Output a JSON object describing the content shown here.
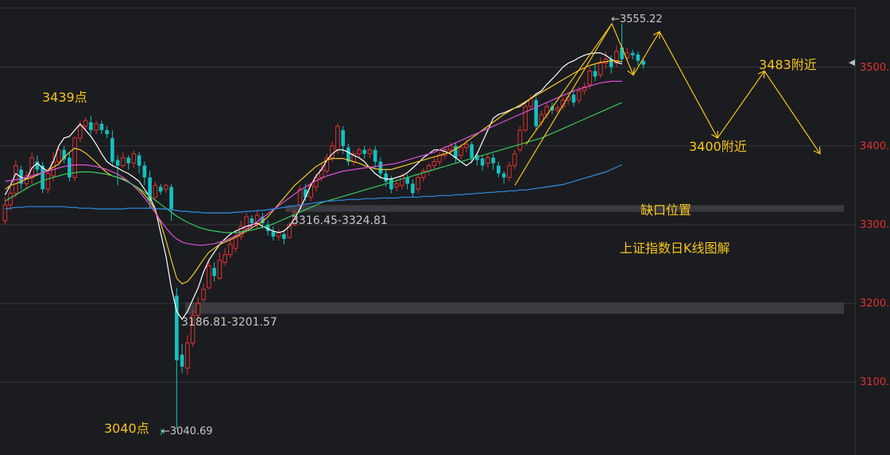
{
  "colors": {
    "background": "#1b1c20",
    "grid": "#34353a",
    "up": "#e0322e",
    "down": "#12c2c0",
    "tick": "#e0322e",
    "annotation": "#f5c518",
    "gap_zone": "#3a3b40",
    "ma5": "#ffffff",
    "ma10": "#f0c828",
    "ma20": "#e050d8",
    "ma30": "#38c860",
    "ma60": "#2f8fe8"
  },
  "chart_data": {
    "type": "candlestick",
    "title": "上证指数日K线图解",
    "ylim": [
      3025,
      3575
    ],
    "y_ticks": [
      "3500.",
      "3400.",
      "3300.",
      "3200.",
      "3100."
    ],
    "grid": true,
    "extreme_labels": {
      "high": "←3555.22",
      "low": "←3040.69",
      "gap_upper": "3316.45-3324.81",
      "gap_lower": "3186.81-3201.57"
    },
    "gaps": [
      {
        "low": 3316.45,
        "high": 3324.81
      },
      {
        "low": 3186.81,
        "high": 3201.57
      }
    ],
    "annotations": {
      "peak_left": "3439点",
      "bottom": "3040点",
      "gap_position": "缺口位置",
      "target_low": "3400附近",
      "target_high": "3483附近"
    },
    "candles": [
      [
        3305,
        3325,
        3300,
        3335
      ],
      [
        3325,
        3340,
        3318,
        3348
      ],
      [
        3340,
        3375,
        3335,
        3382
      ],
      [
        3370,
        3352,
        3345,
        3375
      ],
      [
        3352,
        3362,
        3345,
        3368
      ],
      [
        3360,
        3385,
        3352,
        3392
      ],
      [
        3380,
        3370,
        3362,
        3388
      ],
      [
        3375,
        3345,
        3340,
        3380
      ],
      [
        3345,
        3365,
        3340,
        3372
      ],
      [
        3362,
        3380,
        3355,
        3392
      ],
      [
        3380,
        3395,
        3375,
        3398
      ],
      [
        3395,
        3383,
        3378,
        3400
      ],
      [
        3385,
        3360,
        3355,
        3392
      ],
      [
        3360,
        3410,
        3355,
        3412
      ],
      [
        3410,
        3425,
        3405,
        3432
      ],
      [
        3425,
        3432,
        3420,
        3436
      ],
      [
        3430,
        3420,
        3415,
        3438
      ],
      [
        3420,
        3428,
        3415,
        3432
      ],
      [
        3428,
        3420,
        3415,
        3432
      ],
      [
        3420,
        3415,
        3410,
        3425
      ],
      [
        3410,
        3380,
        3375,
        3420
      ],
      [
        3382,
        3375,
        3350,
        3388
      ],
      [
        3375,
        3385,
        3372,
        3392
      ],
      [
        3385,
        3378,
        3370,
        3388
      ],
      [
        3378,
        3390,
        3372,
        3394
      ],
      [
        3388,
        3375,
        3365,
        3392
      ],
      [
        3375,
        3360,
        3350,
        3380
      ],
      [
        3360,
        3330,
        3320,
        3368
      ],
      [
        3335,
        3350,
        3330,
        3355
      ],
      [
        3348,
        3342,
        3338,
        3352
      ],
      [
        3345,
        3350,
        3340,
        3352
      ],
      [
        3348,
        3320,
        3305,
        3352
      ],
      [
        3210,
        3128,
        3040.69,
        3220
      ],
      [
        3135,
        3120,
        3112,
        3148
      ],
      [
        3118,
        3150,
        3110,
        3160
      ],
      [
        3150,
        3185,
        3145,
        3192
      ],
      [
        3185,
        3200,
        3180,
        3208
      ],
      [
        3205,
        3218,
        3202,
        3225
      ],
      [
        3220,
        3248,
        3218,
        3255
      ],
      [
        3245,
        3235,
        3228,
        3252
      ],
      [
        3232,
        3255,
        3230,
        3265
      ],
      [
        3252,
        3262,
        3248,
        3270
      ],
      [
        3262,
        3275,
        3258,
        3282
      ],
      [
        3270,
        3285,
        3265,
        3292
      ],
      [
        3285,
        3298,
        3280,
        3305
      ],
      [
        3295,
        3310,
        3290,
        3315
      ],
      [
        3308,
        3302,
        3295,
        3312
      ],
      [
        3300,
        3312,
        3295,
        3318
      ],
      [
        3310,
        3302,
        3295,
        3315
      ],
      [
        3300,
        3292,
        3286,
        3305
      ],
      [
        3292,
        3285,
        3280,
        3298
      ],
      [
        3285,
        3290,
        3280,
        3295
      ],
      [
        3288,
        3282,
        3275,
        3294
      ],
      [
        3284,
        3300,
        3282,
        3303
      ],
      [
        3300,
        3316,
        3298,
        3318
      ],
      [
        3325,
        3345,
        3320,
        3350
      ],
      [
        3345,
        3335,
        3330,
        3352
      ],
      [
        3335,
        3350,
        3330,
        3354
      ],
      [
        3348,
        3360,
        3342,
        3365
      ],
      [
        3360,
        3370,
        3355,
        3378
      ],
      [
        3368,
        3385,
        3365,
        3390
      ],
      [
        3385,
        3400,
        3380,
        3405
      ],
      [
        3395,
        3425,
        3390,
        3428
      ],
      [
        3420,
        3400,
        3390,
        3425
      ],
      [
        3398,
        3380,
        3375,
        3403
      ],
      [
        3380,
        3390,
        3375,
        3394
      ],
      [
        3390,
        3395,
        3384,
        3398
      ],
      [
        3395,
        3390,
        3384,
        3400
      ],
      [
        3390,
        3395,
        3384,
        3398
      ],
      [
        3395,
        3380,
        3372,
        3400
      ],
      [
        3380,
        3365,
        3358,
        3385
      ],
      [
        3365,
        3355,
        3348,
        3370
      ],
      [
        3358,
        3345,
        3340,
        3362
      ],
      [
        3348,
        3352,
        3342,
        3358
      ],
      [
        3350,
        3362,
        3345,
        3365
      ],
      [
        3360,
        3352,
        3345,
        3364
      ],
      [
        3352,
        3340,
        3335,
        3358
      ],
      [
        3345,
        3360,
        3340,
        3365
      ],
      [
        3360,
        3368,
        3355,
        3372
      ],
      [
        3368,
        3375,
        3362,
        3378
      ],
      [
        3375,
        3380,
        3370,
        3385
      ],
      [
        3380,
        3388,
        3375,
        3393
      ],
      [
        3388,
        3395,
        3383,
        3398
      ],
      [
        3395,
        3400,
        3390,
        3404
      ],
      [
        3400,
        3385,
        3378,
        3405
      ],
      [
        3388,
        3398,
        3383,
        3402
      ],
      [
        3398,
        3402,
        3392,
        3408
      ],
      [
        3402,
        3385,
        3378,
        3405
      ],
      [
        3388,
        3382,
        3375,
        3392
      ],
      [
        3384,
        3375,
        3368,
        3388
      ],
      [
        3378,
        3385,
        3372,
        3390
      ],
      [
        3385,
        3378,
        3370,
        3390
      ],
      [
        3375,
        3365,
        3360,
        3380
      ],
      [
        3365,
        3360,
        3352,
        3368
      ],
      [
        3360,
        3375,
        3355,
        3380
      ],
      [
        3375,
        3390,
        3370,
        3395
      ],
      [
        3395,
        3420,
        3392,
        3425
      ],
      [
        3420,
        3450,
        3418,
        3455
      ],
      [
        3450,
        3460,
        3445,
        3465
      ],
      [
        3458,
        3425,
        3420,
        3462
      ],
      [
        3430,
        3440,
        3425,
        3445
      ],
      [
        3440,
        3450,
        3435,
        3455
      ],
      [
        3450,
        3445,
        3440,
        3455
      ],
      [
        3445,
        3448,
        3442,
        3452
      ],
      [
        3450,
        3458,
        3446,
        3462
      ],
      [
        3458,
        3462,
        3452,
        3468
      ],
      [
        3465,
        3455,
        3450,
        3470
      ],
      [
        3458,
        3470,
        3454,
        3475
      ],
      [
        3470,
        3475,
        3465,
        3480
      ],
      [
        3478,
        3495,
        3472,
        3500
      ],
      [
        3495,
        3488,
        3482,
        3505
      ],
      [
        3490,
        3505,
        3486,
        3512
      ],
      [
        3505,
        3510,
        3498,
        3520
      ],
      [
        3510,
        3500,
        3492,
        3515
      ],
      [
        3505,
        3520,
        3500,
        3528
      ],
      [
        3525,
        3510,
        3505,
        3555.22
      ],
      [
        3512,
        3518,
        3507,
        3525
      ],
      [
        3518,
        3515,
        3510,
        3522
      ],
      [
        3516,
        3508,
        3502,
        3520
      ],
      [
        3508,
        3503,
        3498,
        3512
      ]
    ],
    "series": [
      {
        "ma": 5,
        "values": [
          3338,
          3350,
          3365,
          3360,
          3358,
          3372,
          3378,
          3372,
          3368,
          3380,
          3400,
          3410,
          3412,
          3420,
          3428,
          3420,
          3412,
          3402,
          3390,
          3380,
          3375,
          3372,
          3368,
          3365,
          3360,
          3355,
          3345,
          3335,
          3320,
          3290,
          3260,
          3220,
          3190,
          3180,
          3190,
          3205,
          3220,
          3240,
          3255,
          3265,
          3275,
          3282,
          3288,
          3292,
          3295,
          3298,
          3300,
          3302,
          3298,
          3295,
          3292,
          3290,
          3292,
          3298,
          3308,
          3320,
          3335,
          3350,
          3362,
          3370,
          3382,
          3390,
          3395,
          3395,
          3392,
          3388,
          3385,
          3380,
          3372,
          3365,
          3360,
          3358,
          3358,
          3360,
          3362,
          3366,
          3372,
          3378,
          3385,
          3390,
          3395,
          3395,
          3393,
          3390,
          3385,
          3380,
          3375,
          3380,
          3390,
          3405,
          3420,
          3435,
          3440,
          3442,
          3445,
          3448,
          3450,
          3455,
          3460,
          3466,
          3470,
          3478,
          3485,
          3492,
          3500,
          3505,
          3508,
          3512,
          3515,
          3517,
          3518,
          3518,
          3515,
          3510,
          3506,
          3504
        ]
      },
      {
        "ma": 10,
        "values": [
          3345,
          3350,
          3352,
          3355,
          3358,
          3360,
          3363,
          3366,
          3369,
          3373,
          3377,
          3385,
          3392,
          3397,
          3395,
          3391,
          3385,
          3379,
          3372,
          3366,
          3362,
          3360,
          3358,
          3354,
          3350,
          3345,
          3338,
          3330,
          3318,
          3302,
          3280,
          3255,
          3232,
          3225,
          3228,
          3236,
          3246,
          3256,
          3265,
          3270,
          3275,
          3278,
          3281,
          3284,
          3288,
          3292,
          3296,
          3300,
          3304,
          3310,
          3318,
          3326,
          3334,
          3342,
          3350,
          3356,
          3362,
          3368,
          3374,
          3378,
          3382,
          3384,
          3384,
          3384,
          3382,
          3380,
          3378,
          3375,
          3373,
          3371,
          3370,
          3370,
          3370,
          3372,
          3374,
          3376,
          3378,
          3380,
          3382,
          3384,
          3386,
          3388,
          3390,
          3392,
          3396,
          3400,
          3405,
          3410,
          3415,
          3420,
          3425,
          3430,
          3435,
          3440,
          3444,
          3448,
          3452,
          3456,
          3460,
          3464,
          3468,
          3472,
          3476,
          3480,
          3484,
          3488,
          3492,
          3496,
          3499,
          3502,
          3504,
          3506,
          3507,
          3508,
          3508,
          3507
        ]
      },
      {
        "ma": 20,
        "values": [
          3355,
          3356,
          3357,
          3358,
          3360,
          3362,
          3364,
          3366,
          3368,
          3370,
          3372,
          3374,
          3375,
          3376,
          3376,
          3376,
          3375,
          3374,
          3372,
          3370,
          3367,
          3364,
          3360,
          3355,
          3349,
          3342,
          3334,
          3325,
          3315,
          3305,
          3296,
          3288,
          3282,
          3278,
          3276,
          3275,
          3274,
          3274,
          3275,
          3276,
          3278,
          3280,
          3283,
          3286,
          3290,
          3294,
          3299,
          3304,
          3309,
          3314,
          3319,
          3324,
          3329,
          3334,
          3339,
          3344,
          3348,
          3352,
          3356,
          3359,
          3362,
          3364,
          3366,
          3368,
          3369,
          3370,
          3371,
          3372,
          3373,
          3374,
          3375,
          3376,
          3377,
          3378,
          3380,
          3382,
          3384,
          3386,
          3388,
          3390,
          3392,
          3395,
          3398,
          3401,
          3404,
          3407,
          3410,
          3413,
          3416,
          3419,
          3422,
          3425,
          3428,
          3431,
          3434,
          3437,
          3440,
          3443,
          3446,
          3449,
          3452,
          3455,
          3458,
          3461,
          3464,
          3467,
          3470,
          3472,
          3474,
          3476,
          3478,
          3480,
          3481,
          3482,
          3482,
          3482
        ]
      },
      {
        "ma": 30,
        "values": [
          3330,
          3334,
          3338,
          3342,
          3346,
          3350,
          3353,
          3356,
          3358,
          3360,
          3362,
          3364,
          3365,
          3366,
          3367,
          3367,
          3367,
          3366,
          3365,
          3364,
          3362,
          3360,
          3357,
          3354,
          3350,
          3346,
          3341,
          3336,
          3331,
          3326,
          3321,
          3316,
          3311,
          3307,
          3303,
          3300,
          3297,
          3295,
          3293,
          3292,
          3291,
          3290,
          3290,
          3290,
          3291,
          3292,
          3293,
          3295,
          3297,
          3299,
          3301,
          3304,
          3307,
          3310,
          3313,
          3316,
          3319,
          3322,
          3325,
          3328,
          3330,
          3332,
          3334,
          3336,
          3338,
          3340,
          3342,
          3344,
          3346,
          3348,
          3350,
          3352,
          3354,
          3356,
          3358,
          3360,
          3362,
          3364,
          3366,
          3368,
          3370,
          3372,
          3374,
          3376,
          3378,
          3380,
          3382,
          3384,
          3386,
          3388,
          3390,
          3392,
          3394,
          3396,
          3398,
          3400,
          3402,
          3404,
          3406,
          3408,
          3410,
          3413,
          3416,
          3419,
          3422,
          3425,
          3428,
          3431,
          3434,
          3437,
          3440,
          3443,
          3446,
          3449,
          3452,
          3455
        ]
      },
      {
        "ma": 60,
        "values": [
          3320,
          3321,
          3322,
          3322,
          3323,
          3323,
          3323,
          3323,
          3323,
          3323,
          3323,
          3323,
          3322,
          3322,
          3321,
          3321,
          3321,
          3320,
          3320,
          3320,
          3320,
          3320,
          3320,
          3321,
          3321,
          3321,
          3321,
          3321,
          3321,
          3320,
          3320,
          3319,
          3318,
          3317,
          3317,
          3316,
          3316,
          3315,
          3315,
          3315,
          3315,
          3315,
          3315,
          3316,
          3316,
          3317,
          3317,
          3318,
          3318,
          3319,
          3320,
          3321,
          3322,
          3323,
          3324,
          3325,
          3326,
          3327,
          3328,
          3329,
          3330,
          3330,
          3331,
          3331,
          3332,
          3332,
          3332,
          3333,
          3333,
          3333,
          3334,
          3334,
          3334,
          3334,
          3335,
          3335,
          3335,
          3335,
          3336,
          3336,
          3336,
          3337,
          3337,
          3337,
          3338,
          3338,
          3339,
          3339,
          3340,
          3340,
          3341,
          3341,
          3342,
          3342,
          3343,
          3343,
          3344,
          3344,
          3345,
          3346,
          3347,
          3348,
          3349,
          3350,
          3351,
          3353,
          3355,
          3357,
          3359,
          3361,
          3363,
          3365,
          3367,
          3370,
          3373,
          3376
        ]
      }
    ],
    "forecast_path": [
      3350,
      3555,
      3490,
      3545,
      3410,
      3495,
      3390
    ]
  }
}
